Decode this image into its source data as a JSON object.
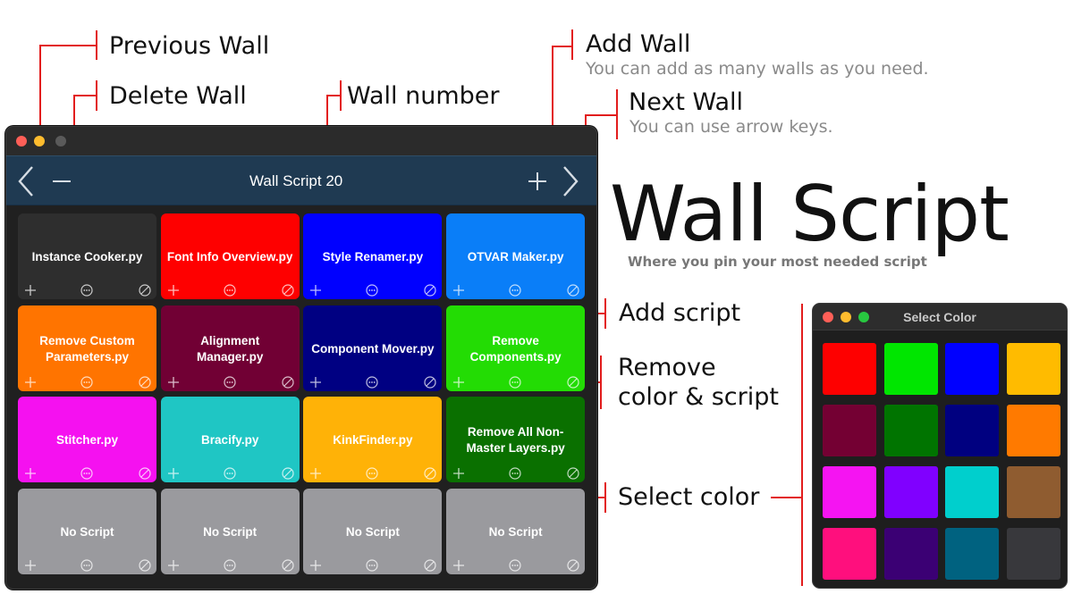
{
  "annotations": {
    "previous_wall": "Previous Wall",
    "delete_wall": "Delete Wall",
    "wall_number": "Wall number",
    "add_wall": "Add Wall",
    "add_wall_note": "You can add as many walls as you need.",
    "next_wall": "Next Wall",
    "next_wall_note": "You can use arrow keys.",
    "add_script": "Add script",
    "remove_color_script": "Remove\ncolor & script",
    "select_color": "Select color"
  },
  "hero": {
    "title": "Wall Script",
    "subtitle": "Where you pin your most needed script"
  },
  "main_window": {
    "wall_title": "Wall Script 20",
    "icons": [
      "chevron-left-icon",
      "minus-icon",
      "plus-icon",
      "chevron-right-icon"
    ],
    "tiles": [
      {
        "label": "Instance Cooker.py",
        "color": "#2e2e2e"
      },
      {
        "label": "Font Info Overview.py",
        "color": "#fe0000"
      },
      {
        "label": "Style Renamer.py",
        "color": "#0000ff"
      },
      {
        "label": "OTVAR Maker.py",
        "color": "#0a7ef8"
      },
      {
        "label": "Remove Custom Parameters.py",
        "color": "#ff7400"
      },
      {
        "label": "Alignment Manager.py",
        "color": "#710034"
      },
      {
        "label": "Component Mover.py",
        "color": "#000082"
      },
      {
        "label": "Remove Components.py",
        "color": "#23dc04"
      },
      {
        "label": "Stitcher.py",
        "color": "#f511f0"
      },
      {
        "label": "Bracify.py",
        "color": "#1fc6c4"
      },
      {
        "label": "KinkFinder.py",
        "color": "#ffb207"
      },
      {
        "label": "Remove All Non-Master Layers.py",
        "color": "#0a7000"
      },
      {
        "label": "No Script",
        "color": "#9a9a9e"
      },
      {
        "label": "No Script",
        "color": "#9a9a9e"
      },
      {
        "label": "No Script",
        "color": "#9a9a9e"
      },
      {
        "label": "No Script",
        "color": "#9a9a9e"
      }
    ]
  },
  "color_window": {
    "title": "Select Color",
    "swatches": [
      "#fe0000",
      "#00e600",
      "#0000ff",
      "#ffbb00",
      "#740033",
      "#007400",
      "#000080",
      "#ff7a00",
      "#f514f2",
      "#8000ff",
      "#00cfcd",
      "#8f5c30",
      "#ff0f7d",
      "#3b0074",
      "#006280",
      "#38383c"
    ]
  },
  "colors": {
    "annotation_red": "#e21d1d",
    "toolbar_bg": "#1f3a52"
  }
}
